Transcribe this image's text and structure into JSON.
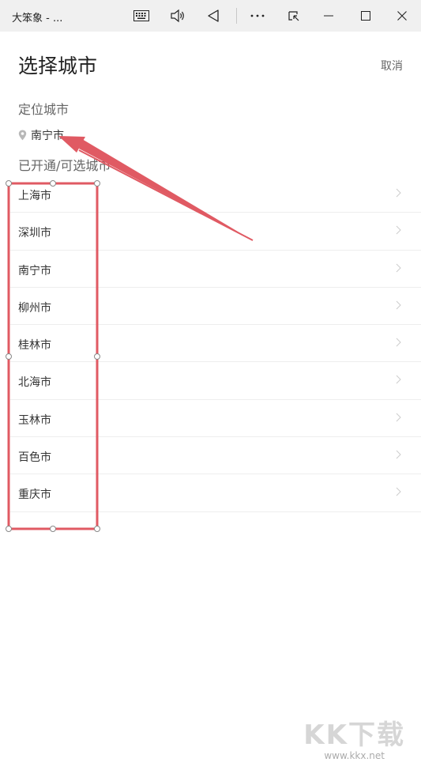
{
  "window": {
    "title": "大笨象 - ...",
    "buttons": [
      "keyboard-icon",
      "volume-icon",
      "back-triangle-icon",
      "more-icon",
      "snap-icon",
      "minimize-icon",
      "maximize-icon",
      "close-icon"
    ]
  },
  "page": {
    "title": "选择城市",
    "cancel_label": "取消"
  },
  "located": {
    "section_label": "定位城市",
    "city": "南宁市",
    "icon": "location-pin-icon"
  },
  "available": {
    "section_label": "已开通/可选城市",
    "cities": [
      "上海市",
      "深圳市",
      "南宁市",
      "柳州市",
      "桂林市",
      "北海市",
      "玉林市",
      "百色市",
      "重庆市"
    ]
  },
  "colors": {
    "annotation": "#e05a63",
    "titlebar_bg": "#f0f0f0",
    "divider": "#eeeeee"
  },
  "watermark": {
    "big": "KK下载",
    "small": "www.kkx.net"
  }
}
